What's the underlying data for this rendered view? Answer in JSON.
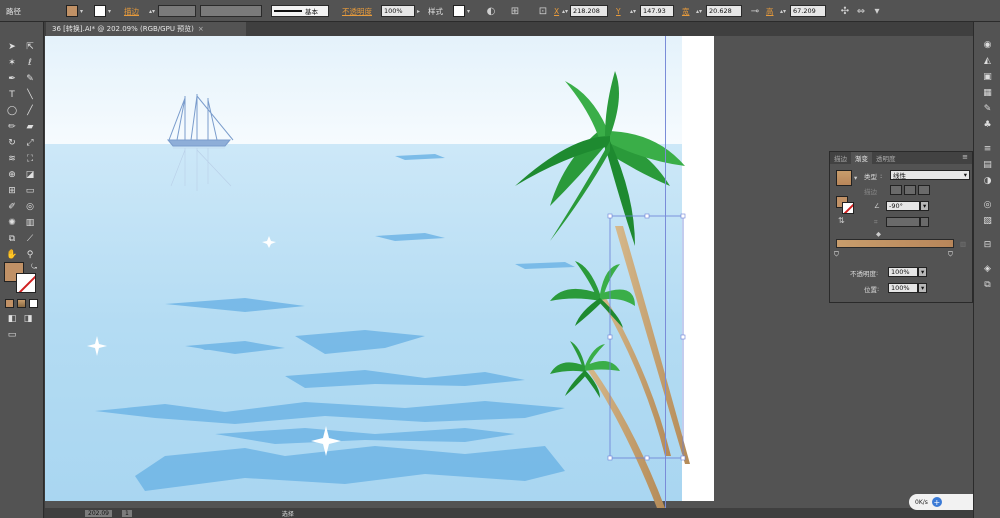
{
  "control_bar": {
    "path_label": "路径",
    "stroke_label": "描边",
    "stroke_style": "基本",
    "opacity_label": "不透明度",
    "opacity_value": "100%",
    "style_label": "样式",
    "x_label": "X",
    "x_value": "218.208",
    "y_label": "Y",
    "y_value": "147.93",
    "w_label": "宽",
    "w_value": "20.628",
    "h_label": "高",
    "h_value": "67.209"
  },
  "document": {
    "tab_title": "36 [转换].AI* @ 202.09% (RGB/GPU 预览)",
    "close_glyph": "×"
  },
  "status_bar": {
    "zoom": "202.09",
    "page": "1",
    "selection_tool": "选择"
  },
  "gradient_panel": {
    "tabs": [
      "描边",
      "渐变",
      "透明度"
    ],
    "active_tab": "渐变",
    "type_label": "类型",
    "type_value": "线性",
    "stroke_label": "描边",
    "angle_value": "-90°",
    "opacity_label": "不透明度",
    "opacity_value": "100%",
    "location_label": "位置",
    "location_value": "100%",
    "menu_glyph": "≡"
  },
  "tools": {
    "fill_color": "#c09166",
    "stroke_color": "#ffffff"
  },
  "speed_widget": {
    "value": "0K/s"
  },
  "colors": {
    "sky_top": "#e3f1fb",
    "sea": "#aed9f2",
    "water_streak": "#6fb5e6",
    "palm_leaf": "#2a9a3a",
    "palm_trunk": "#c5a06d",
    "ui_bg": "#535353",
    "accent": "#e89b3b"
  }
}
